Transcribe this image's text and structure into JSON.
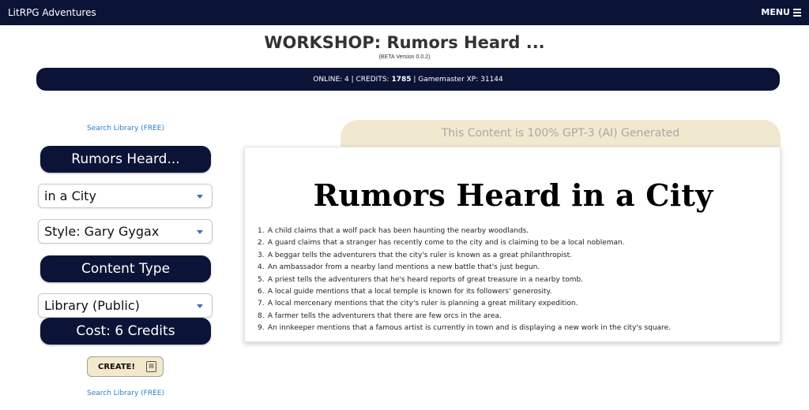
{
  "topbar": {
    "brand": "LitRPG Adventures",
    "menu_label": "MENU"
  },
  "header": {
    "title": "WORKSHOP: Rumors Heard ...",
    "version": "(BETA Version 0.0.2)"
  },
  "status": {
    "online_label": "ONLINE: 4 | CREDITS: ",
    "credits": "1785",
    "xp_label": " | Gamemaster XP: 31144"
  },
  "sidebar": {
    "search_link_top": "Search Library (FREE)",
    "generator_title": "Rumors Heard...",
    "location_select": "in a City",
    "style_select": "Style: Gary Gygax",
    "content_type_title": "Content Type",
    "content_type_select": "Library (Public)",
    "cost_label": "Cost: 6 Credits",
    "create_label": "CREATE!",
    "search_link_bottom": "Search Library (FREE)"
  },
  "content": {
    "ai_notice": "This Content is 100% GPT-3 (AI) Generated",
    "title": "Rumors Heard in a City",
    "rumors": [
      "A child claims that a wolf pack has been haunting the nearby woodlands.",
      "A guard claims that a stranger has recently come to the city and is claiming to be a local nobleman.",
      "A beggar tells the adventurers that the city's ruler is known as a great philanthropist.",
      "An ambassador from a nearby land mentions a new battle that's just begun.",
      "A priest tells the adventurers that he's heard reports of great treasure in a nearby tomb.",
      "A local guide mentions that a local temple is known for its followers' generosity.",
      "A local mercenary mentions that the city's ruler is planning a great military expedition.",
      "A farmer tells the adventurers that there are few orcs in the area.",
      "An innkeeper mentions that a famous artist is currently in town and is displaying a new work in the city's square."
    ]
  },
  "icons": {
    "menu": "hamburger-icon",
    "dropdown": "chevron-down-icon",
    "create": "document-icon"
  },
  "colors": {
    "navy": "#0b1437",
    "cream": "#f1e8d0",
    "link": "#2a7fd0"
  }
}
